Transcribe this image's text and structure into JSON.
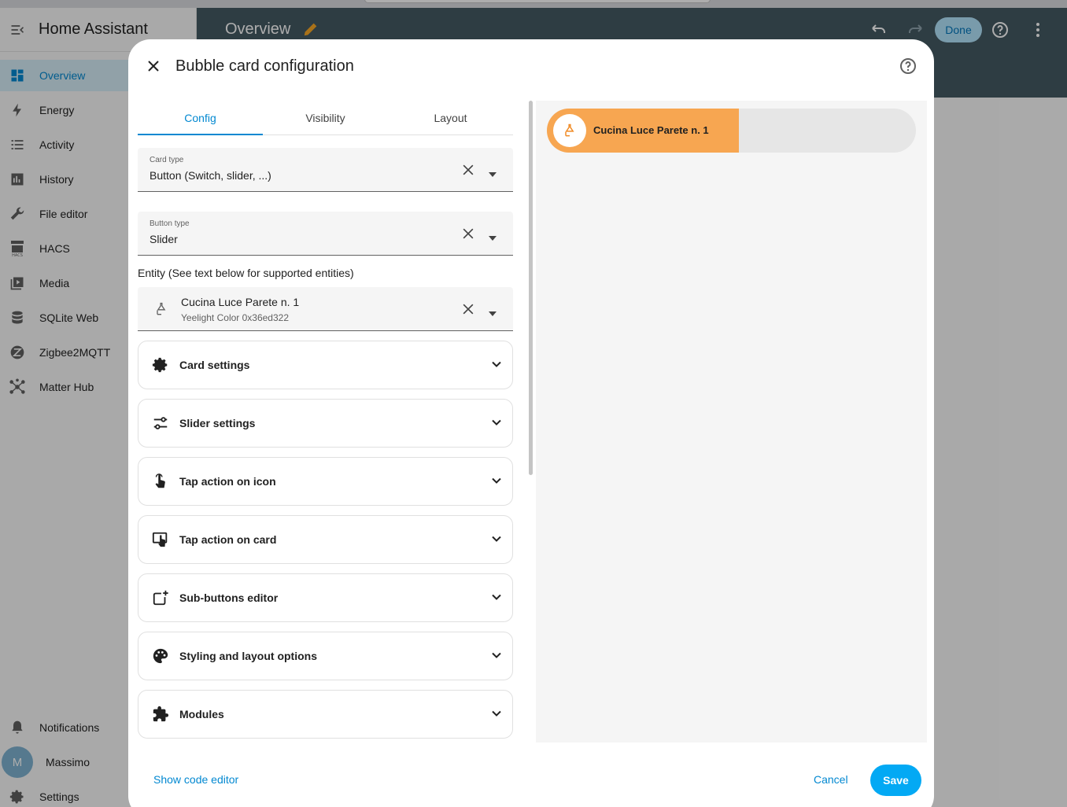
{
  "app": {
    "title": "Home Assistant",
    "page_title": "Overview",
    "done_label": "Done"
  },
  "sidebar": {
    "items": [
      {
        "label": "Overview",
        "icon": "dashboard-icon",
        "active": true
      },
      {
        "label": "Energy",
        "icon": "lightning-icon"
      },
      {
        "label": "Activity",
        "icon": "list-icon"
      },
      {
        "label": "History",
        "icon": "chart-icon"
      },
      {
        "label": "File editor",
        "icon": "wrench-icon"
      },
      {
        "label": "HACS",
        "icon": "hacs-icon"
      },
      {
        "label": "Media",
        "icon": "media-icon"
      },
      {
        "label": "SQLite Web",
        "icon": "database-icon"
      },
      {
        "label": "Zigbee2MQTT",
        "icon": "zigbee-icon"
      },
      {
        "label": "Matter Hub",
        "icon": "hub-icon"
      }
    ],
    "notifications_label": "Notifications",
    "user_initial": "M",
    "user_name": "Massimo",
    "settings_label": "Settings"
  },
  "dialog": {
    "title": "Bubble card configuration",
    "tabs": [
      {
        "label": "Config",
        "active": true
      },
      {
        "label": "Visibility"
      },
      {
        "label": "Layout"
      }
    ],
    "card_type": {
      "label": "Card type",
      "value": "Button (Switch, slider, ...)"
    },
    "button_type": {
      "label": "Button type",
      "value": "Slider"
    },
    "entity_label": "Entity (See text below for supported entities)",
    "entity": {
      "name": "Cucina Luce Parete n. 1",
      "sub": "Yeelight Color 0x36ed322"
    },
    "panels": [
      {
        "label": "Card settings",
        "icon": "gear-icon"
      },
      {
        "label": "Slider settings",
        "icon": "tune-icon"
      },
      {
        "label": "Tap action on icon",
        "icon": "tap-icon"
      },
      {
        "label": "Tap action on card",
        "icon": "monitor-tap-icon"
      },
      {
        "label": "Sub-buttons editor",
        "icon": "add-square-icon"
      },
      {
        "label": "Styling and layout options",
        "icon": "palette-icon"
      },
      {
        "label": "Modules",
        "icon": "puzzle-icon"
      }
    ],
    "show_code_label": "Show code editor",
    "cancel_label": "Cancel",
    "save_label": "Save"
  },
  "preview": {
    "name": "Cucina Luce Parete n. 1",
    "slider_fraction": 0.52,
    "accent": "#f7a651"
  },
  "colors": {
    "primary": "#03a9f4",
    "header": "#455a64",
    "accent_orange": "#f7a651"
  }
}
